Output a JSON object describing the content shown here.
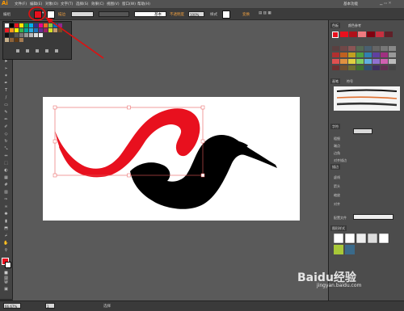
{
  "app": {
    "logo": "Ai"
  },
  "menus": [
    "文件(F)",
    "编辑(E)",
    "对象(O)",
    "文字(T)",
    "选择(S)",
    "效果(C)",
    "视图(V)",
    "窗口(W)",
    "帮助(H)"
  ],
  "workspace_label": "基本功能",
  "control_bar": {
    "selection_label": "编组",
    "stroke_label": "描边",
    "stroke_weight": "",
    "brush_label": "基本",
    "opacity_label": "不透明度",
    "opacity_value": "100%",
    "style_label": "样式",
    "align_label": "变换"
  },
  "right_panel": {
    "swatches_tab": "色板",
    "color_ref_tab": "颜色参考",
    "brushes_tab": "画笔",
    "symbols_tab": "符号",
    "character_tab": "字符",
    "stroke_tab": "描边",
    "stroke_rows": [
      "粗细",
      "端点",
      "边角",
      "对齐描边"
    ],
    "dashed_label": "虚线",
    "arrow_label": "箭头",
    "scale_label": "缩放",
    "align_label": "对齐",
    "profile_label": "配置文件",
    "graphic_styles_tab": "图形样式"
  },
  "status": {
    "zoom": "66.67%",
    "page": "1",
    "mode": "选择"
  },
  "watermark": {
    "brand": "Baidu经验",
    "url": "jingyan.baidu.com"
  },
  "colors": {
    "accent_red": "#e8101e",
    "annotation_red": "#e01010",
    "ui_dark": "#3c3c3c"
  }
}
